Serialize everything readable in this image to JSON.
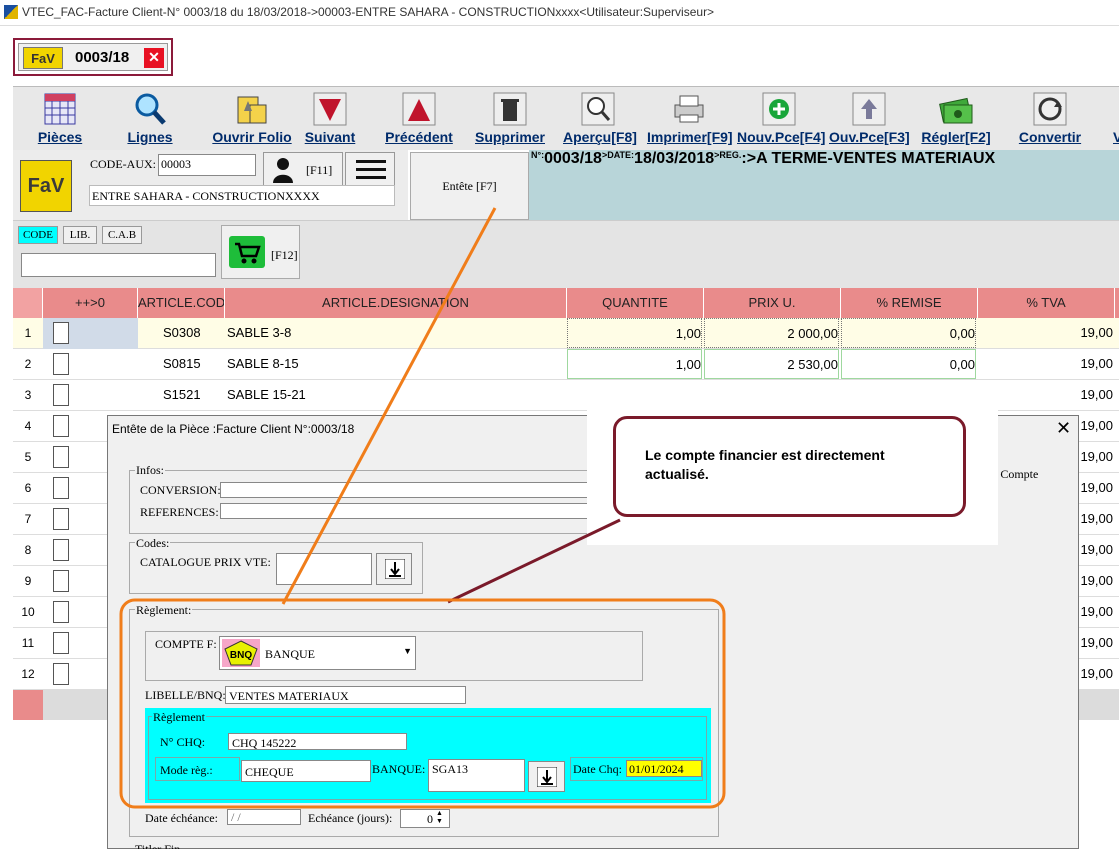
{
  "window": {
    "title": "VTEC_FAC-Facture Client-N° 0003/18 du 18/03/2018->00003-ENTRE SAHARA - CONSTRUCTIONxxxx<Utilisateur:Superviseur>"
  },
  "doc_tab": {
    "logo": "FaV",
    "number": "0003/18",
    "close": "✕"
  },
  "toolbar": {
    "pieces": "Pièces",
    "lignes": "Lignes",
    "ouvrir_folio": "Ouvrir Folio",
    "suivant": "Suivant",
    "precedent": "Précédent",
    "supprimer": "Supprimer",
    "apercu": "Aperçu[F8]",
    "imprimer": "Imprimer[F9]",
    "nouv_pce": "Nouv.Pce[F4]",
    "ouv_pce": "Ouv.Pce[F3]",
    "regler": "Régler[F2]",
    "convertir": "Convertir",
    "more": "V"
  },
  "header": {
    "logo": "FaV",
    "code_aux_label": "CODE-AUX:",
    "code_aux_value": "00003",
    "user_key": "[F11]",
    "client_name": "ENTRE SAHARA - CONSTRUCTIONXXXX",
    "entete_button": "Entête [F7]",
    "num_prefix": "N°:",
    "num": "0003/18",
    "date_prefix": ">DATE:",
    "date": "18/03/2018",
    "reg_prefix": ">REG.",
    "reg": ":>A TERME-VENTES MATERIAUX"
  },
  "search": {
    "tabs": [
      "CODE",
      "LIB.",
      "C.A.B"
    ],
    "cart_key": "[F12]"
  },
  "grid": {
    "columns": [
      "++>0",
      "ARTICLE.COD",
      "ARTICLE.DESIGNATION",
      "QUANTITE",
      "PRIX U.",
      "% REMISE",
      "% TVA"
    ],
    "rows": [
      {
        "n": "1",
        "code": "S0308",
        "designation": "SABLE 3-8",
        "qte": "1,00",
        "prix": "2 000,00",
        "remise": "0,00",
        "tva": "19,00"
      },
      {
        "n": "2",
        "code": "S0815",
        "designation": "SABLE 8-15",
        "qte": "1,00",
        "prix": "2 530,00",
        "remise": "0,00",
        "tva": "19,00"
      },
      {
        "n": "3",
        "code": "S1521",
        "designation": "SABLE 15-21",
        "qte": "",
        "prix": "",
        "remise": "",
        "tva": "19,00"
      },
      {
        "n": "4",
        "tva": "19,00"
      },
      {
        "n": "5",
        "tva": "19,00"
      },
      {
        "n": "6",
        "tva": "19,00"
      },
      {
        "n": "7",
        "tva": "19,00"
      },
      {
        "n": "8",
        "tva": "19,00"
      },
      {
        "n": "9",
        "tva": "19,00"
      },
      {
        "n": "10",
        "tva": "19,00"
      },
      {
        "n": "11",
        "tva": "19,00"
      },
      {
        "n": "12",
        "tva": "19,00"
      }
    ]
  },
  "dialog": {
    "title": "Entête de la Pièce :Facture Client N°:0003/18",
    "close": "✕",
    "infos_label": "Infos:",
    "conversion_label": "CONVERSION:",
    "references_label": "REFERENCES:",
    "codes_label": "Codes:",
    "catalogue_label": "CATALOGUE PRIX VTE:",
    "reglement_label": "Règlement:",
    "compte_label": "COMPTE F:",
    "compte_icon": "BNQ",
    "compte_value": "BANQUE",
    "libelle_label": "LIBELLE/BNQ:",
    "libelle_value": "VENTES MATERIAUX",
    "reglement_sub_label": "Règlement",
    "chq_label": "N° CHQ:",
    "chq_value": "CHQ  145222",
    "mode_label": "Mode règ.:",
    "mode_value": "CHEQUE",
    "banque_label": "BANQUE:",
    "banque_value": "SGA13",
    "date_chq_label": "Date Chq:",
    "date_chq_value": "01/01/2024",
    "date_echeance_label": "Date échéance:",
    "date_echeance_value": "/ /",
    "echeance_jours_label": "Echéance (jours):",
    "echeance_jours_value": "0",
    "partial_right": "ue Compte",
    "bottom_partial": "Titler Fin..."
  },
  "callout": {
    "text": "Le compte financier est directement actualisé."
  },
  "colors": {
    "accent_pink": "#e98b8b",
    "cyan": "#00ffff",
    "callout_border": "#7a1a2a",
    "orange_annotation": "#f07d1a",
    "header_info": "#b8d5d9"
  }
}
